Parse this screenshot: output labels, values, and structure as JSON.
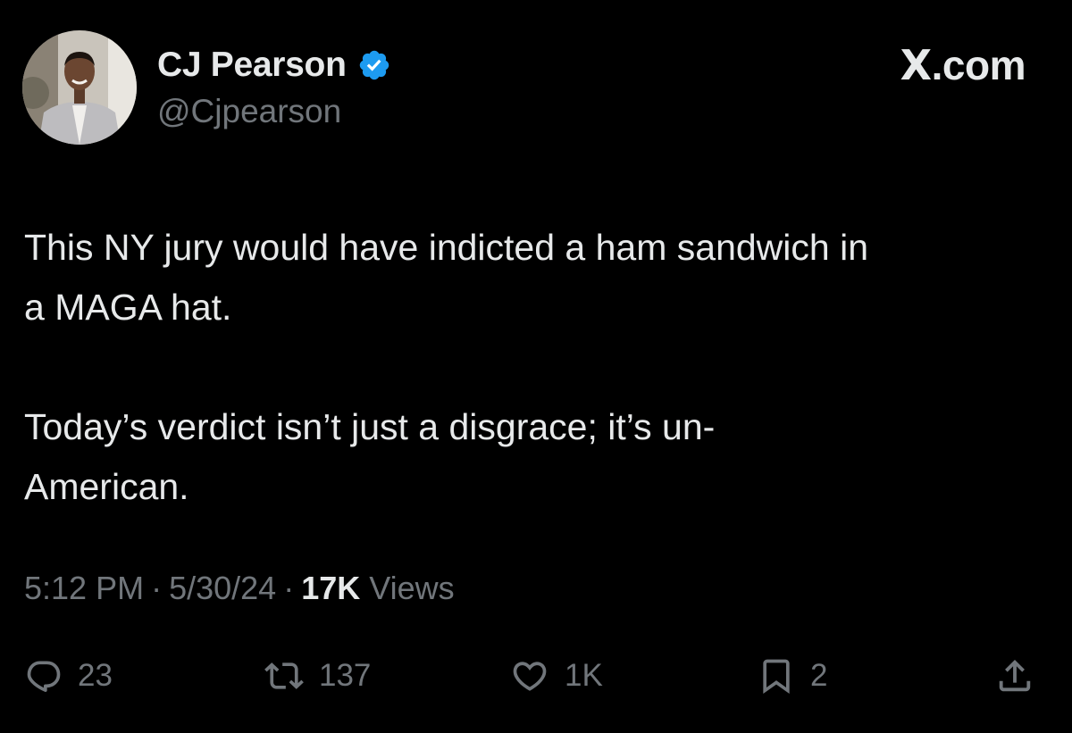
{
  "user": {
    "display_name": "CJ Pearson",
    "handle": "@Cjpearson",
    "verified": true,
    "avatar_icon": "profile-photo"
  },
  "brand": {
    "name": "X.com",
    "x_glyph": "X",
    "suffix": ".com"
  },
  "tweet": {
    "paragraphs": [
      "This NY jury would have indicted a ham sandwich in\na MAGA hat.",
      "Today’s verdict isn’t just a disgrace; it’s un-\nAmerican."
    ]
  },
  "meta": {
    "time": "5:12 PM",
    "date": "5/30/24",
    "separator": "·",
    "views_count": "17K",
    "views_label": "Views"
  },
  "actions": {
    "reply": {
      "icon": "reply-icon",
      "count": "23"
    },
    "repost": {
      "icon": "repost-icon",
      "count": "137"
    },
    "like": {
      "icon": "heart-icon",
      "count": "1K"
    },
    "bookmark": {
      "icon": "bookmark-icon",
      "count": "2"
    },
    "share": {
      "icon": "share-icon"
    }
  },
  "colors": {
    "background": "#000000",
    "primary_text": "#e7e9ea",
    "secondary_text": "#71767b",
    "verified_blue": "#1d9bf0"
  }
}
